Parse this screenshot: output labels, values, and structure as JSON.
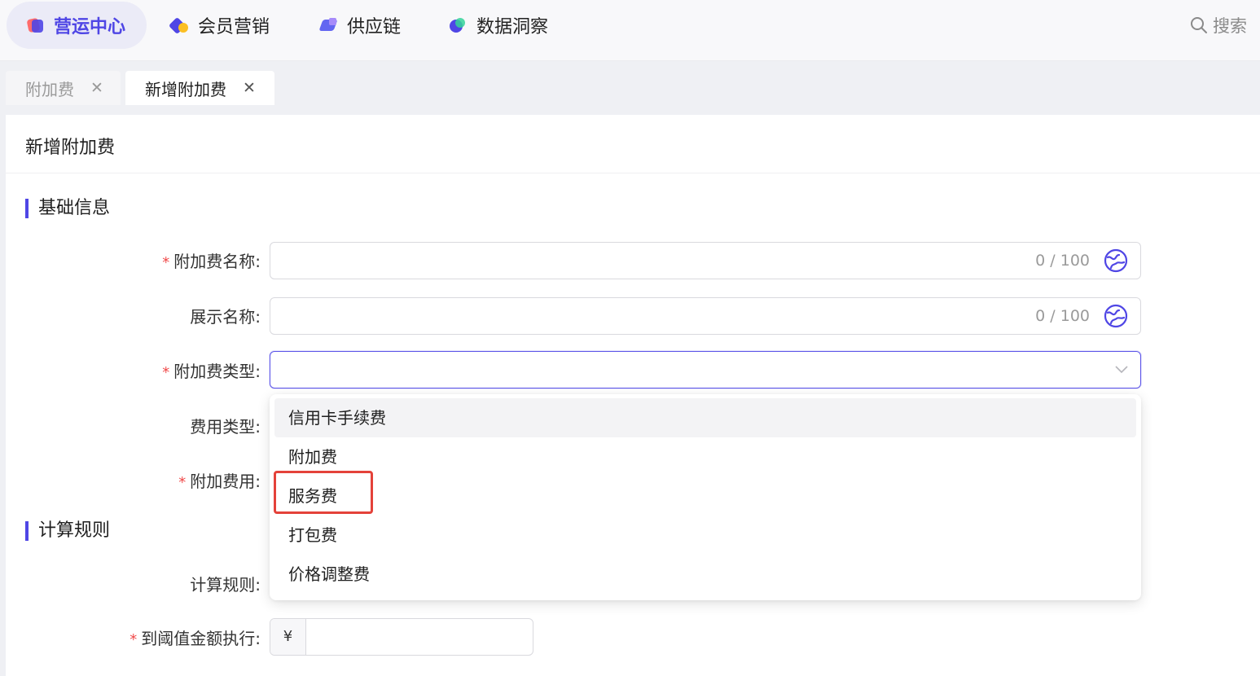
{
  "nav": {
    "items": [
      {
        "label": "营运中心",
        "icon": "ops-center-icon",
        "active": true
      },
      {
        "label": "会员营销",
        "icon": "member-marketing-icon",
        "active": false
      },
      {
        "label": "供应链",
        "icon": "supply-chain-icon",
        "active": false
      },
      {
        "label": "数据洞察",
        "icon": "data-insight-icon",
        "active": false
      }
    ],
    "search_label": "搜索"
  },
  "tabs": [
    {
      "label": "附加费",
      "close": "✕",
      "active": false
    },
    {
      "label": "新增附加费",
      "close": "✕",
      "active": true
    }
  ],
  "page": {
    "title": "新增附加费",
    "sections": {
      "basic": "基础信息",
      "calc": "计算规则"
    }
  },
  "form": {
    "surcharge_name": {
      "label": "附加费名称:",
      "required": true,
      "counter": "0 / 100",
      "value": ""
    },
    "display_name": {
      "label": "展示名称:",
      "required": false,
      "counter": "0 / 100",
      "value": ""
    },
    "surcharge_type": {
      "label": "附加费类型:",
      "required": true,
      "value": ""
    },
    "fee_type": {
      "label": "费用类型:",
      "required": false
    },
    "surcharge_amount": {
      "label": "附加费用:",
      "required": true
    },
    "calc_rule": {
      "label": "计算规则:",
      "required": false
    },
    "threshold": {
      "label": "到阈值金额执行:",
      "required": true,
      "currency": "¥",
      "value": ""
    }
  },
  "dropdown": {
    "options": [
      "信用卡手续费",
      "附加费",
      "服务费",
      "打包费",
      "价格调整费"
    ],
    "hovered_index": 0,
    "highlighted_index": 2
  },
  "colors": {
    "accent": "#4f46e5",
    "required": "#f04a4a",
    "highlight_box": "#e4423a"
  }
}
